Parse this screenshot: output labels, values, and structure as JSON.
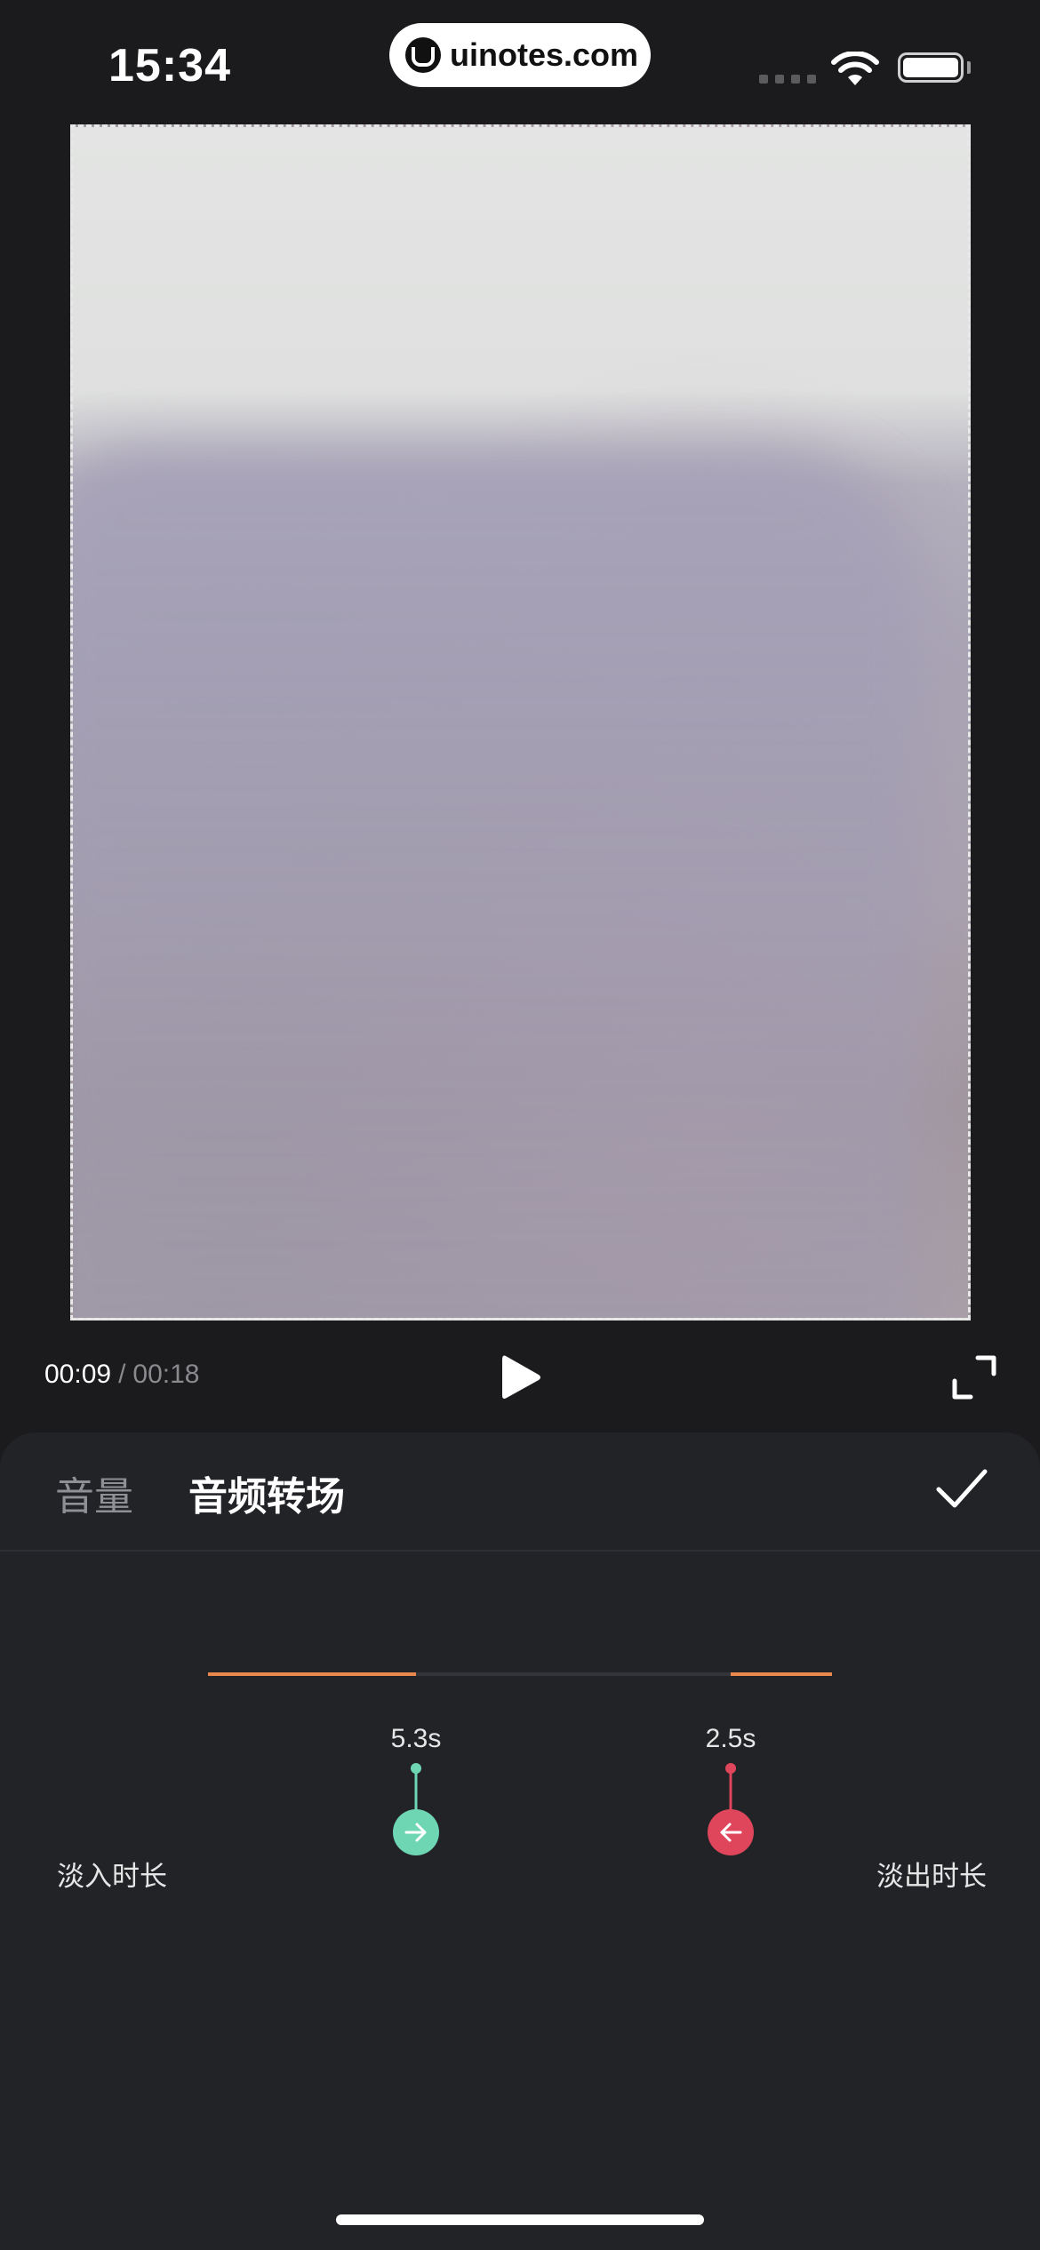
{
  "status_bar": {
    "time": "15:34",
    "watermark": "uinotes.com"
  },
  "playback": {
    "current_time": "00:09",
    "separator": "/",
    "total_time": "00:18"
  },
  "panel": {
    "tabs": [
      {
        "label": "音量",
        "active": false
      },
      {
        "label": "音频转场",
        "active": true
      }
    ]
  },
  "fade": {
    "fade_in_label": "淡入时长",
    "fade_out_label": "淡出时长",
    "fade_in_value": "5.3s",
    "fade_out_value": "2.5s",
    "fade_in_color": "#6fd6b4",
    "fade_out_color": "#e0465b",
    "accent_color": "#e9874f"
  }
}
